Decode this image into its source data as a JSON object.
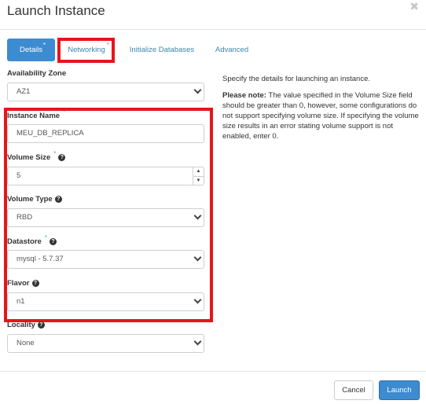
{
  "dialog": {
    "title": "Launch Instance",
    "close_icon": "close-icon"
  },
  "tabs": [
    {
      "label": "Details",
      "required": "*",
      "active": true
    },
    {
      "label": "Networking",
      "required": "*",
      "active": false
    },
    {
      "label": "Initialize Databases",
      "active": false
    },
    {
      "label": "Advanced",
      "active": false
    }
  ],
  "form": {
    "availability_zone": {
      "label": "Availability Zone",
      "value": "AZ1"
    },
    "instance_name": {
      "label": "Instance Name",
      "required": "*",
      "value": "MEU_DB_REPLICA"
    },
    "volume_size": {
      "label": "Volume Size",
      "required": "*",
      "value": "5",
      "help_icon": "question-circle-icon"
    },
    "volume_type": {
      "label": "Volume Type",
      "value": "RBD",
      "help_icon": "question-circle-icon"
    },
    "datastore": {
      "label": "Datastore",
      "required": "*",
      "value": "mysql - 5.7.37",
      "help_icon": "question-circle-icon"
    },
    "flavor": {
      "label": "Flavor",
      "value": "n1",
      "help_icon": "question-circle-icon"
    },
    "locality": {
      "label": "Locality",
      "value": "None",
      "help_icon": "question-circle-icon"
    }
  },
  "help_text": {
    "intro": "Specify the details for launching an instance.",
    "note_label": "Please note:",
    "note_body": " The value specified in the Volume Size field should be greater than 0, however, some configurations do not support specifying volume size. If specifying the volume size results in an error stating volume support is not enabled, enter 0."
  },
  "footer": {
    "cancel_label": "Cancel",
    "launch_label": "Launch"
  },
  "colors": {
    "primary": "#3d8bd1",
    "highlight_box": "#e8141c",
    "required_star": "#5a9bd5"
  }
}
